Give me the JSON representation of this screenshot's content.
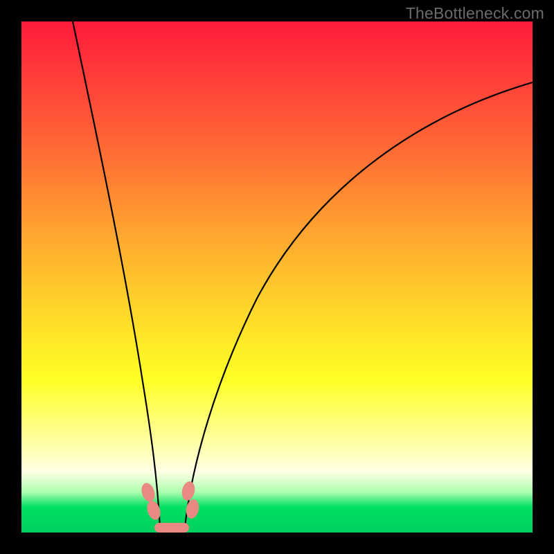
{
  "watermark": "TheBottleneck.com",
  "chart_data": {
    "type": "line",
    "title": "",
    "xlabel": "",
    "ylabel": "",
    "xlim": [
      0,
      100
    ],
    "ylim": [
      0,
      100
    ],
    "series": [
      {
        "name": "left-curve",
        "x": [
          10,
          12,
          14,
          16,
          18,
          20,
          22,
          24,
          25.5,
          27
        ],
        "y": [
          100,
          82,
          65,
          50,
          36,
          24,
          14,
          7,
          3,
          0.5
        ]
      },
      {
        "name": "right-curve",
        "x": [
          32,
          34,
          38,
          44,
          52,
          62,
          74,
          88,
          100
        ],
        "y": [
          0.5,
          6,
          18,
          34,
          50,
          64,
          75,
          83,
          88
        ]
      }
    ],
    "annotations": [
      {
        "name": "blob-left-upper",
        "x": 24.5,
        "y": 7
      },
      {
        "name": "blob-left-lower",
        "x": 25.5,
        "y": 3
      },
      {
        "name": "blob-right-upper",
        "x": 32.5,
        "y": 7
      },
      {
        "name": "blob-right-lower",
        "x": 33.5,
        "y": 3
      },
      {
        "name": "blob-bottom-bar",
        "x": 29,
        "y": 0.5
      }
    ],
    "background_gradient": {
      "top": "#ff1a3a",
      "mid_upper": "#ffa030",
      "mid": "#ffff25",
      "mid_lower": "#ffffe6",
      "bottom": "#00d060"
    }
  }
}
